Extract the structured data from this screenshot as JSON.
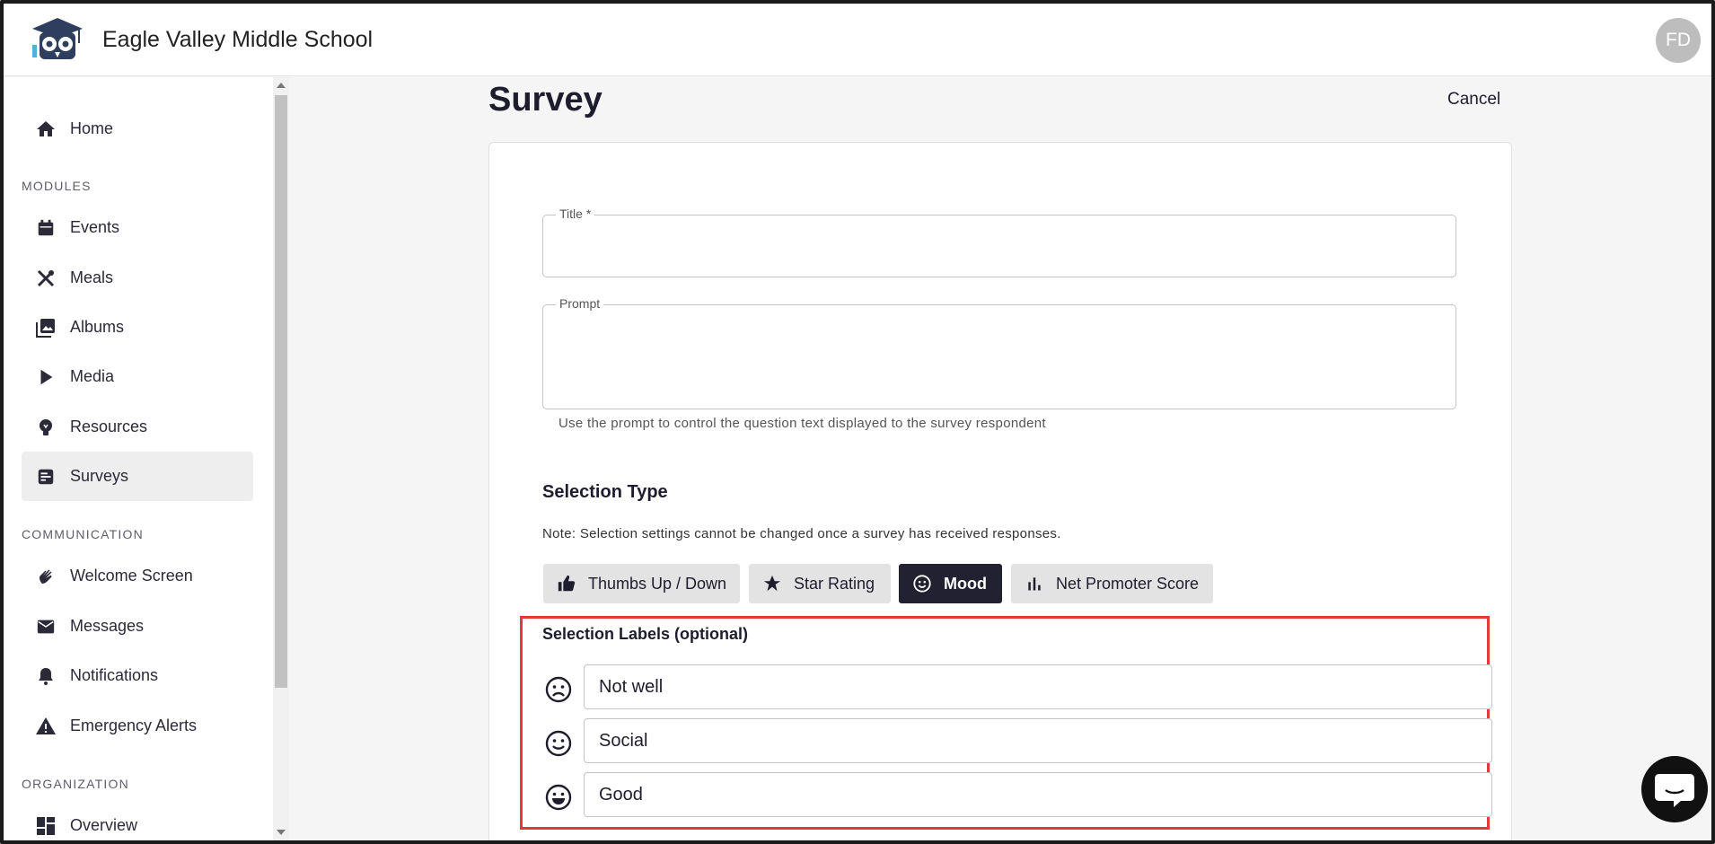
{
  "header": {
    "school_name": "Eagle Valley Middle School",
    "avatar_initials": "FD"
  },
  "sidebar": {
    "home": "Home",
    "sections": {
      "modules": "MODULES",
      "communication": "COMMUNICATION",
      "organization": "ORGANIZATION"
    },
    "modules": [
      {
        "label": "Events",
        "icon": "calendar-icon"
      },
      {
        "label": "Meals",
        "icon": "utensils-icon"
      },
      {
        "label": "Albums",
        "icon": "photo-library-icon"
      },
      {
        "label": "Media",
        "icon": "play-icon"
      },
      {
        "label": "Resources",
        "icon": "lightbulb-icon"
      },
      {
        "label": "Surveys",
        "icon": "survey-icon",
        "active": true
      }
    ],
    "communication": [
      {
        "label": "Welcome Screen",
        "icon": "waving-hand-icon"
      },
      {
        "label": "Messages",
        "icon": "mail-icon"
      },
      {
        "label": "Notifications",
        "icon": "bell-icon"
      },
      {
        "label": "Emergency Alerts",
        "icon": "warning-icon"
      }
    ],
    "organization": [
      {
        "label": "Overview",
        "icon": "dashboard-icon"
      }
    ]
  },
  "page": {
    "title": "Survey",
    "cancel_label": "Cancel"
  },
  "form": {
    "title_label": "Title *",
    "title_value": "",
    "prompt_label": "Prompt",
    "prompt_value": "",
    "prompt_helper": "Use the prompt to control the question text displayed to the survey respondent",
    "selection_type_title": "Selection Type",
    "selection_note": "Note: Selection settings cannot be changed once a survey has received responses.",
    "selection_types": [
      {
        "label": "Thumbs Up / Down",
        "icon": "thumbs-up-icon",
        "selected": false
      },
      {
        "label": "Star Rating",
        "icon": "star-icon",
        "selected": false
      },
      {
        "label": "Mood",
        "icon": "smiley-icon",
        "selected": true
      },
      {
        "label": "Net Promoter Score",
        "icon": "bar-chart-icon",
        "selected": false
      }
    ],
    "selection_labels_title": "Selection Labels (optional)",
    "selection_labels": [
      {
        "value": "Not well",
        "icon": "sad-face-icon"
      },
      {
        "value": "Social",
        "icon": "neutral-smile-icon"
      },
      {
        "value": "Good",
        "icon": "happy-face-icon"
      }
    ]
  },
  "colors": {
    "primary": "#222131",
    "highlight": "#e53935",
    "logo": "#2f3e5e"
  }
}
